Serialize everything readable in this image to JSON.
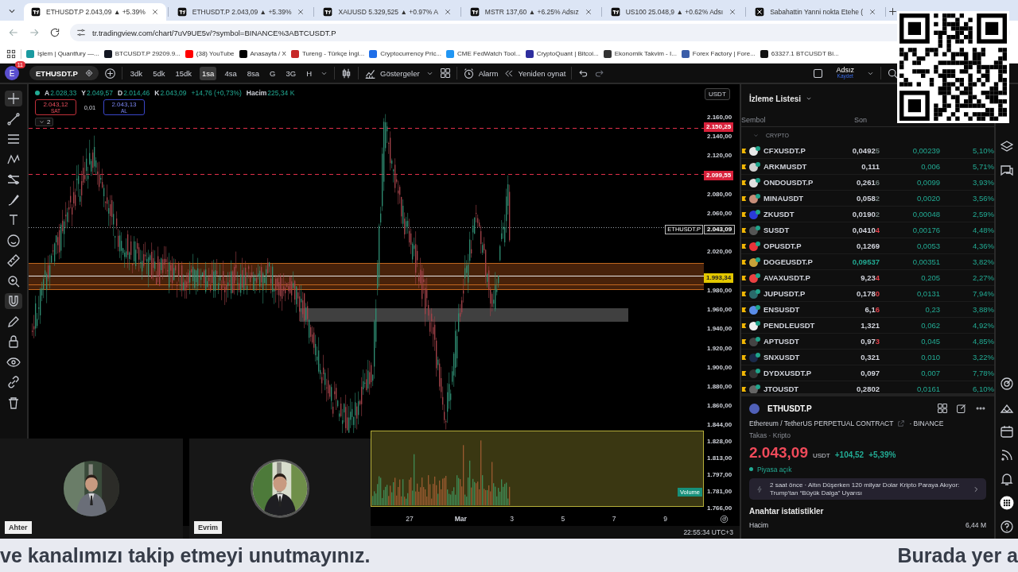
{
  "browser": {
    "tabs": [
      {
        "title": "ETHUSDT.P 2.043,09 ▲ +5.39%",
        "kind": "chart",
        "selected": true
      },
      {
        "title": "ETHUSDT.P 2.043,09 ▲ +5.39%",
        "kind": "chart",
        "selected": false
      },
      {
        "title": "XAUUSD 5.329,525 ▲ +0.97% A",
        "kind": "chart",
        "selected": false
      },
      {
        "title": "MSTR 137,60 ▲ +6.25% Adsız",
        "kind": "chart",
        "selected": false
      },
      {
        "title": "US100 25.048,9 ▲ +0.62% Adsı",
        "kind": "chart",
        "selected": false
      },
      {
        "title": "Sabahattin Yanni nokta Etehe (",
        "kind": "social",
        "selected": false
      }
    ],
    "address": "tr.tradingview.com/chart/7uV9UE5v/?symbol=BINANCE%3ABTCUSDT.P",
    "bookmarks": [
      {
        "label": "İşlem | Quantfury —...",
        "color": "#1a9aa0"
      },
      {
        "label": "BTCUSDT.P 29209.9...",
        "color": "#131722"
      },
      {
        "label": "(38) YouTube",
        "color": "#ff0000"
      },
      {
        "label": "Anasayfa / X",
        "color": "#000000"
      },
      {
        "label": "Tureng - Türkçe İngi...",
        "color": "#c62828"
      },
      {
        "label": "Cryptocurrency Pric...",
        "color": "#1e6ee8"
      },
      {
        "label": "CME FedWatch Tool...",
        "color": "#2196f3"
      },
      {
        "label": "CryptoQuant | Bitcoi...",
        "color": "#2e2e9e"
      },
      {
        "label": "Ekonomik Takvim - I...",
        "color": "#333333"
      },
      {
        "label": "Forex Factory | Fore...",
        "color": "#3a5da8"
      },
      {
        "label": "63327.1 BTCUSDT Bi...",
        "color": "#111111"
      }
    ]
  },
  "toolbar": {
    "avatar": "E",
    "badge": "11",
    "symbol": "ETHUSDT.P",
    "intervals": [
      {
        "label": "3dk",
        "selected": false
      },
      {
        "label": "5dk",
        "selected": false
      },
      {
        "label": "15dk",
        "selected": false
      },
      {
        "label": "1sa",
        "selected": true
      },
      {
        "label": "4sa",
        "selected": false
      },
      {
        "label": "8sa",
        "selected": false
      },
      {
        "label": "G",
        "selected": false
      },
      {
        "label": "3G",
        "selected": false
      },
      {
        "label": "H",
        "selected": false
      }
    ],
    "indicators": "Göstergeler",
    "alarm": "Alarm",
    "replay": "Yeniden oynat",
    "layout_name": "Adsız",
    "layout_action": "Kaydet"
  },
  "drawing_tools": [
    {
      "kind": "crosshair",
      "selected": true
    },
    {
      "kind": "trend-line",
      "selected": false
    },
    {
      "kind": "lines",
      "selected": false
    },
    {
      "kind": "zigzag",
      "selected": false
    },
    {
      "kind": "nodes",
      "selected": false
    },
    {
      "kind": "brush",
      "selected": false
    },
    {
      "kind": "text",
      "selected": false
    },
    {
      "kind": "smiley",
      "selected": false
    },
    {
      "kind": "ruler",
      "selected": false
    },
    {
      "kind": "zoom",
      "selected": false
    },
    {
      "kind": "magnet",
      "selected": true
    },
    {
      "kind": "pencil",
      "selected": false
    },
    {
      "kind": "lock",
      "selected": false
    },
    {
      "kind": "eye",
      "selected": false
    },
    {
      "kind": "link",
      "selected": false
    },
    {
      "kind": "trash",
      "selected": false
    }
  ],
  "legend": {
    "values": [
      {
        "key": "A",
        "value": "2.028,33"
      },
      {
        "key": "Y",
        "value": "2.049,57"
      },
      {
        "key": "D",
        "value": "2.014,46"
      },
      {
        "key": "K",
        "value": "2.043,09"
      }
    ],
    "change": "+14,76 (+0,73%)",
    "volume_key": "Hacim",
    "volume": "225,34 K",
    "sell": {
      "price": "2.043,12",
      "label": "SAT"
    },
    "spread": "0,01",
    "buy": {
      "price": "2.043,13",
      "label": "AL"
    },
    "collapse": "2"
  },
  "currency": "USDT",
  "price_axis": {
    "ticks": [
      "2.160,00",
      "2.140,00",
      "2.120,00",
      "2.080,00",
      "2.060,00",
      "2.020,00",
      "1.980,00",
      "1.960,00",
      "1.940,00",
      "1.920,00",
      "1.900,00",
      "1.880,00",
      "1.860,00"
    ],
    "volume_ticks": [
      "1.844,00",
      "1.828,00",
      "1.813,00",
      "1.797,00",
      "1.781,00",
      "1.766,00"
    ],
    "tags": [
      {
        "text": "2.150,25",
        "kind": "alert"
      },
      {
        "text": "2.099,55",
        "kind": "alert"
      },
      {
        "text": "2.043,09",
        "kind": "last",
        "symbol": "ETHUSDT.P"
      },
      {
        "text": "1.993,34",
        "kind": "level"
      }
    ],
    "volume_label": "Volume"
  },
  "time_axis": [
    {
      "label": "27",
      "kind": "day"
    },
    {
      "label": "Mar",
      "kind": "month"
    },
    {
      "label": "3",
      "kind": "day"
    },
    {
      "label": "5",
      "kind": "day"
    },
    {
      "label": "7",
      "kind": "day"
    },
    {
      "label": "9",
      "kind": "day"
    }
  ],
  "clock": "22:55:34 UTC+3",
  "watchlist": {
    "title": "İzleme Listesi",
    "columns": [
      "Sembol",
      "Son"
    ],
    "group": "CRYPTO",
    "rows": [
      {
        "symbol": "CFXUSDT.P",
        "last": "0,04925",
        "kind": "flat",
        "change": "0,00239",
        "percent": "5,10%",
        "color": "#e8e8e8"
      },
      {
        "symbol": "ARKMUSDT",
        "last": "0,111",
        "kind": "plain",
        "change": "0,006",
        "percent": "5,71%",
        "color": "#cfcfcf"
      },
      {
        "symbol": "ONDOUSDT.P",
        "last": "0,2616",
        "kind": "flat",
        "change": "0,0099",
        "percent": "3,93%",
        "color": "#e0e0e0"
      },
      {
        "symbol": "MINAUSDT",
        "last": "0,0582",
        "kind": "flat",
        "change": "0,0020",
        "percent": "3,56%",
        "color": "#c78e7a"
      },
      {
        "symbol": "ZKUSDT",
        "last": "0,01902",
        "kind": "flat",
        "change": "0,00048",
        "percent": "2,59%",
        "color": "#2b3bd8"
      },
      {
        "symbol": "SUSDT",
        "last": "0,04104",
        "kind": "down",
        "change": "0,00176",
        "percent": "4,48%",
        "color": "#555555"
      },
      {
        "symbol": "OPUSDT.P",
        "last": "0,1269",
        "kind": "plain",
        "change": "0,0053",
        "percent": "4,36%",
        "color": "#e8343a"
      },
      {
        "symbol": "DOGEUSDT.P",
        "last": "0,09537",
        "kind": "up",
        "change": "0,00351",
        "percent": "3,82%",
        "color": "#c7a23a"
      },
      {
        "symbol": "AVAXUSDT.P",
        "last": "9,234",
        "kind": "down",
        "change": "0,205",
        "percent": "2,27%",
        "color": "#e84142"
      },
      {
        "symbol": "JUPUSDT.P",
        "last": "0,1780",
        "kind": "down",
        "change": "0,0131",
        "percent": "7,94%",
        "color": "#2a6a6a"
      },
      {
        "symbol": "ENSUSDT",
        "last": "6,16",
        "kind": "down",
        "change": "0,23",
        "percent": "3,88%",
        "color": "#5a8ce8"
      },
      {
        "symbol": "PENDLEUSDT",
        "last": "1,321",
        "kind": "plain",
        "change": "0,062",
        "percent": "4,92%",
        "color": "#f0f0f0"
      },
      {
        "symbol": "APTUSDT",
        "last": "0,973",
        "kind": "down",
        "change": "0,045",
        "percent": "4,85%",
        "color": "#444444"
      },
      {
        "symbol": "SNXUSDT",
        "last": "0,321",
        "kind": "plain",
        "change": "0,010",
        "percent": "3,22%",
        "color": "#1b2a4a"
      },
      {
        "symbol": "DYDXUSDT.P",
        "last": "0,097",
        "kind": "plain",
        "change": "0,007",
        "percent": "7,78%",
        "color": "#333333"
      },
      {
        "symbol": "JTOUSDT",
        "last": "0,2802",
        "kind": "plain",
        "change": "0,0161",
        "percent": "6,10%",
        "color": "#666666"
      }
    ]
  },
  "details": {
    "symbol": "ETHUSDT.P",
    "description": "Ethereum / TetherUS PERPETUAL CONTRACT",
    "exchange": "· BINANCE",
    "category": "Takas · Kripto",
    "price": "2.043,09",
    "currency": "USDT",
    "change": "+104,52",
    "percent": "+5,39%",
    "market": "Piyasa açık",
    "news": "2 saat önce · Altın Düşerken 120 milyar Dolar Kripto Paraya Akıyor: Trump'tan “Büyük Dalga” Uyarısı",
    "stats_title": "Anahtar istatistikler",
    "stats": [
      {
        "label": "Hacim",
        "value": "6,44 M"
      }
    ]
  },
  "videos": [
    {
      "name": "Ahter"
    },
    {
      "name": "Evrim"
    }
  ],
  "ticker": [
    "ve kanalımızı takip etmeyi unutmayınız.",
    "Burada yer a"
  ]
}
